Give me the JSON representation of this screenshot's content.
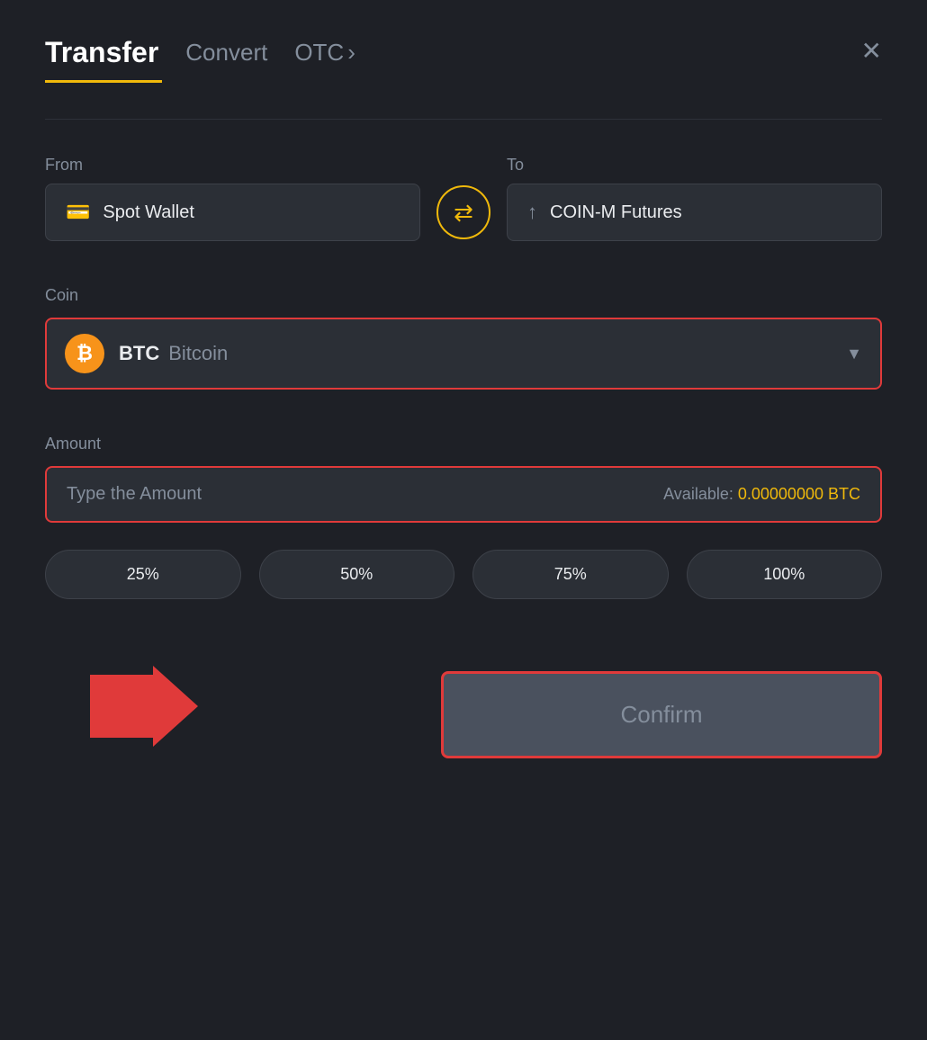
{
  "header": {
    "active_tab": "Transfer",
    "tabs": [
      "Transfer",
      "Convert",
      "OTC"
    ],
    "otc_chevron": "›",
    "close_icon": "✕"
  },
  "from_label": "From",
  "to_label": "To",
  "from_wallet": {
    "icon": "💳",
    "label": "Spot Wallet"
  },
  "to_wallet": {
    "icon": "↑",
    "label": "COIN-M Futures"
  },
  "swap_icon": "⇄",
  "coin_section": {
    "label": "Coin",
    "selected_coin": "BTC",
    "selected_coin_full": "Bitcoin",
    "chevron": "▼"
  },
  "amount_section": {
    "label": "Amount",
    "placeholder": "Type the Amount",
    "available_label": "Available:",
    "available_amount": "0.00000000",
    "available_currency": "BTC"
  },
  "percent_buttons": [
    "25%",
    "50%",
    "75%",
    "100%"
  ],
  "confirm_button": {
    "label": "Confirm"
  }
}
